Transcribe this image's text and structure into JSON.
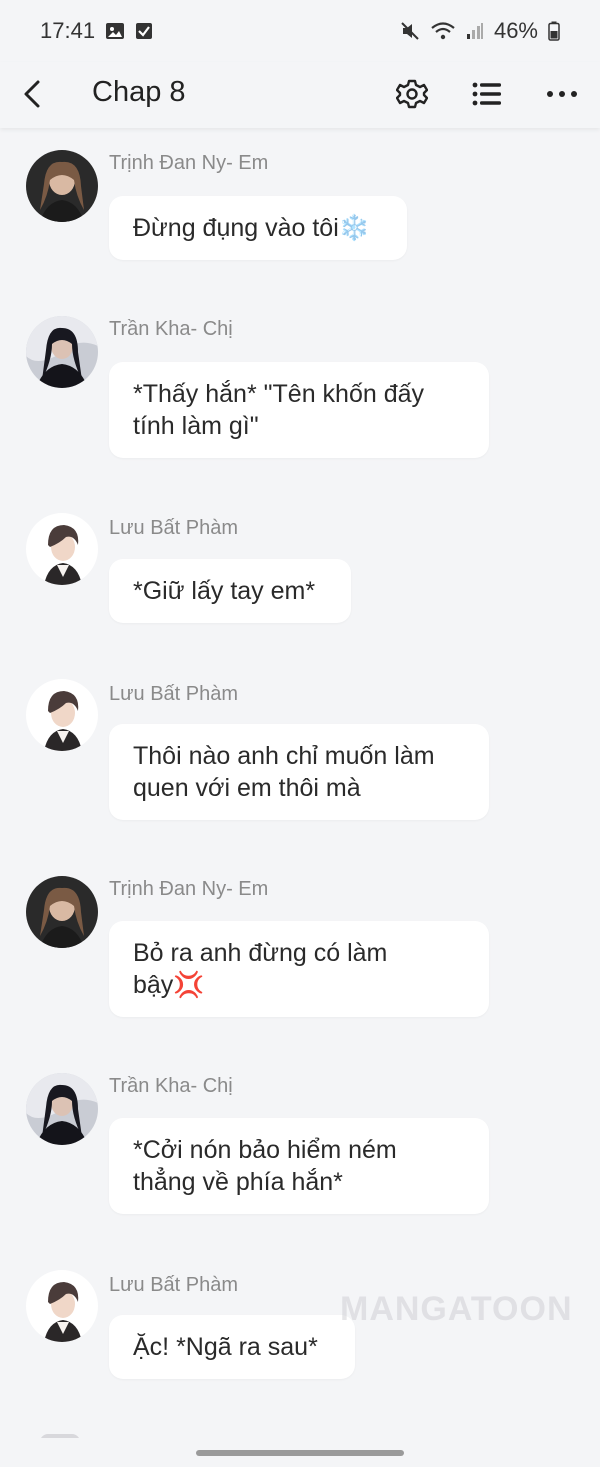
{
  "status_bar": {
    "time": "17:41",
    "battery": "46%",
    "icons": [
      "image-icon",
      "checkbox-icon",
      "mute-icon",
      "wifi-icon",
      "signal-icon",
      "battery-icon"
    ]
  },
  "header": {
    "title": "Chap 8",
    "icons": [
      "back-arrow-icon",
      "gear-icon",
      "list-icon",
      "more-dots-icon"
    ]
  },
  "messages": [
    {
      "sender": "Trịnh Đan Ny- Em",
      "text": "Đừng đụng vào tôi❄️"
    },
    {
      "sender": "Trần Kha- Chị",
      "text": "*Thấy hắn* \"Tên khốn đấy tính làm gì\""
    },
    {
      "sender": "Lưu Bất Phàm",
      "text": "*Giữ lấy tay em*"
    },
    {
      "sender": "Lưu Bất Phàm",
      "text": "Thôi nào anh chỉ muốn làm quen với em thôi mà"
    },
    {
      "sender": "Trịnh Đan Ny- Em",
      "text": "Bỏ ra anh đừng có làm bậy💢"
    },
    {
      "sender": "Trần Kha- Chị",
      "text": "*Cởi nón bảo hiểm ném thẳng về phía hắn*"
    },
    {
      "sender": "Lưu Bất Phàm",
      "text": "Ặc! *Ngã ra sau*"
    }
  ],
  "watermark": "MANGATOON"
}
